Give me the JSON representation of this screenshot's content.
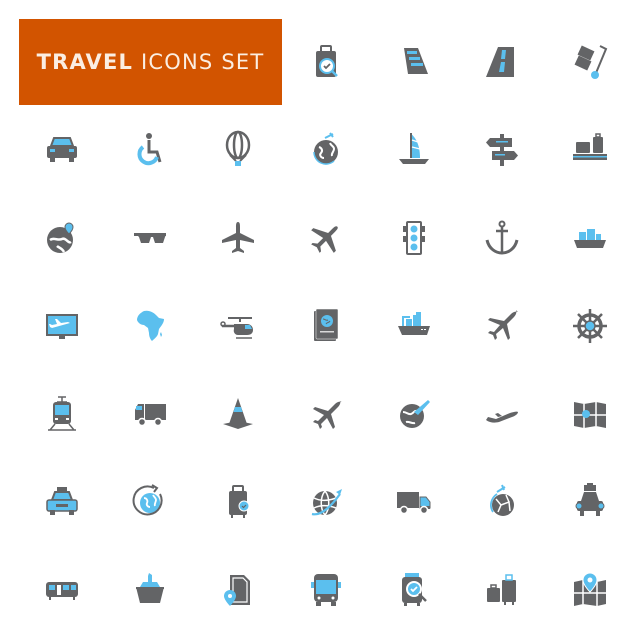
{
  "banner": {
    "title_bold": "TRAVEL",
    "title_rest": "ICONS SET",
    "background": "#d25400",
    "text_color": "#fbeee2"
  },
  "palette": {
    "gray": "#636466",
    "blue": "#5bbfee"
  },
  "icons": [
    {
      "row": 0,
      "col": 3,
      "name": "luggage-check-icon"
    },
    {
      "row": 0,
      "col": 4,
      "name": "railway-track-icon"
    },
    {
      "row": 0,
      "col": 5,
      "name": "road-icon"
    },
    {
      "row": 0,
      "col": 6,
      "name": "hand-truck-icon"
    },
    {
      "row": 1,
      "col": 0,
      "name": "car-icon"
    },
    {
      "row": 1,
      "col": 1,
      "name": "wheelchair-icon"
    },
    {
      "row": 1,
      "col": 2,
      "name": "hot-air-balloon-icon"
    },
    {
      "row": 1,
      "col": 3,
      "name": "globe-flight-icon"
    },
    {
      "row": 1,
      "col": 4,
      "name": "sailboat-icon"
    },
    {
      "row": 1,
      "col": 5,
      "name": "signpost-icon"
    },
    {
      "row": 1,
      "col": 6,
      "name": "baggage-conveyor-icon"
    },
    {
      "row": 2,
      "col": 0,
      "name": "globe-location-icon"
    },
    {
      "row": 2,
      "col": 1,
      "name": "sunglasses-icon"
    },
    {
      "row": 2,
      "col": 2,
      "name": "airplane-icon"
    },
    {
      "row": 2,
      "col": 3,
      "name": "airplane-diagonal-icon"
    },
    {
      "row": 2,
      "col": 4,
      "name": "traffic-light-icon"
    },
    {
      "row": 2,
      "col": 5,
      "name": "anchor-icon"
    },
    {
      "row": 2,
      "col": 6,
      "name": "cargo-ship-icon"
    },
    {
      "row": 3,
      "col": 0,
      "name": "flight-monitor-icon"
    },
    {
      "row": 3,
      "col": 1,
      "name": "africa-map-icon"
    },
    {
      "row": 3,
      "col": 2,
      "name": "helicopter-icon"
    },
    {
      "row": 3,
      "col": 3,
      "name": "passport-icon"
    },
    {
      "row": 3,
      "col": 4,
      "name": "container-ship-icon"
    },
    {
      "row": 3,
      "col": 5,
      "name": "airplane-takeoff-icon"
    },
    {
      "row": 3,
      "col": 6,
      "name": "ship-wheel-icon"
    },
    {
      "row": 4,
      "col": 0,
      "name": "tram-icon"
    },
    {
      "row": 4,
      "col": 1,
      "name": "truck-icon"
    },
    {
      "row": 4,
      "col": 2,
      "name": "traffic-cone-icon"
    },
    {
      "row": 4,
      "col": 3,
      "name": "airplane-outline-icon"
    },
    {
      "row": 4,
      "col": 4,
      "name": "globe-plane-icon"
    },
    {
      "row": 4,
      "col": 5,
      "name": "airplane-side-icon"
    },
    {
      "row": 4,
      "col": 6,
      "name": "folded-map-pin-icon"
    },
    {
      "row": 5,
      "col": 0,
      "name": "taxi-icon"
    },
    {
      "row": 5,
      "col": 1,
      "name": "globe-refresh-icon"
    },
    {
      "row": 5,
      "col": 2,
      "name": "suitcase-check-icon"
    },
    {
      "row": 5,
      "col": 3,
      "name": "globe-flight-path-icon"
    },
    {
      "row": 5,
      "col": 4,
      "name": "delivery-truck-icon"
    },
    {
      "row": 5,
      "col": 5,
      "name": "globe-route-icon"
    },
    {
      "row": 5,
      "col": 6,
      "name": "car-roof-luggage-icon"
    },
    {
      "row": 6,
      "col": 0,
      "name": "train-icon"
    },
    {
      "row": 6,
      "col": 1,
      "name": "cruise-ship-icon"
    },
    {
      "row": 6,
      "col": 2,
      "name": "document-location-icon"
    },
    {
      "row": 6,
      "col": 3,
      "name": "bus-icon"
    },
    {
      "row": 6,
      "col": 4,
      "name": "baggage-scan-icon"
    },
    {
      "row": 6,
      "col": 5,
      "name": "luggage-set-icon"
    },
    {
      "row": 6,
      "col": 6,
      "name": "map-pin-icon"
    }
  ]
}
